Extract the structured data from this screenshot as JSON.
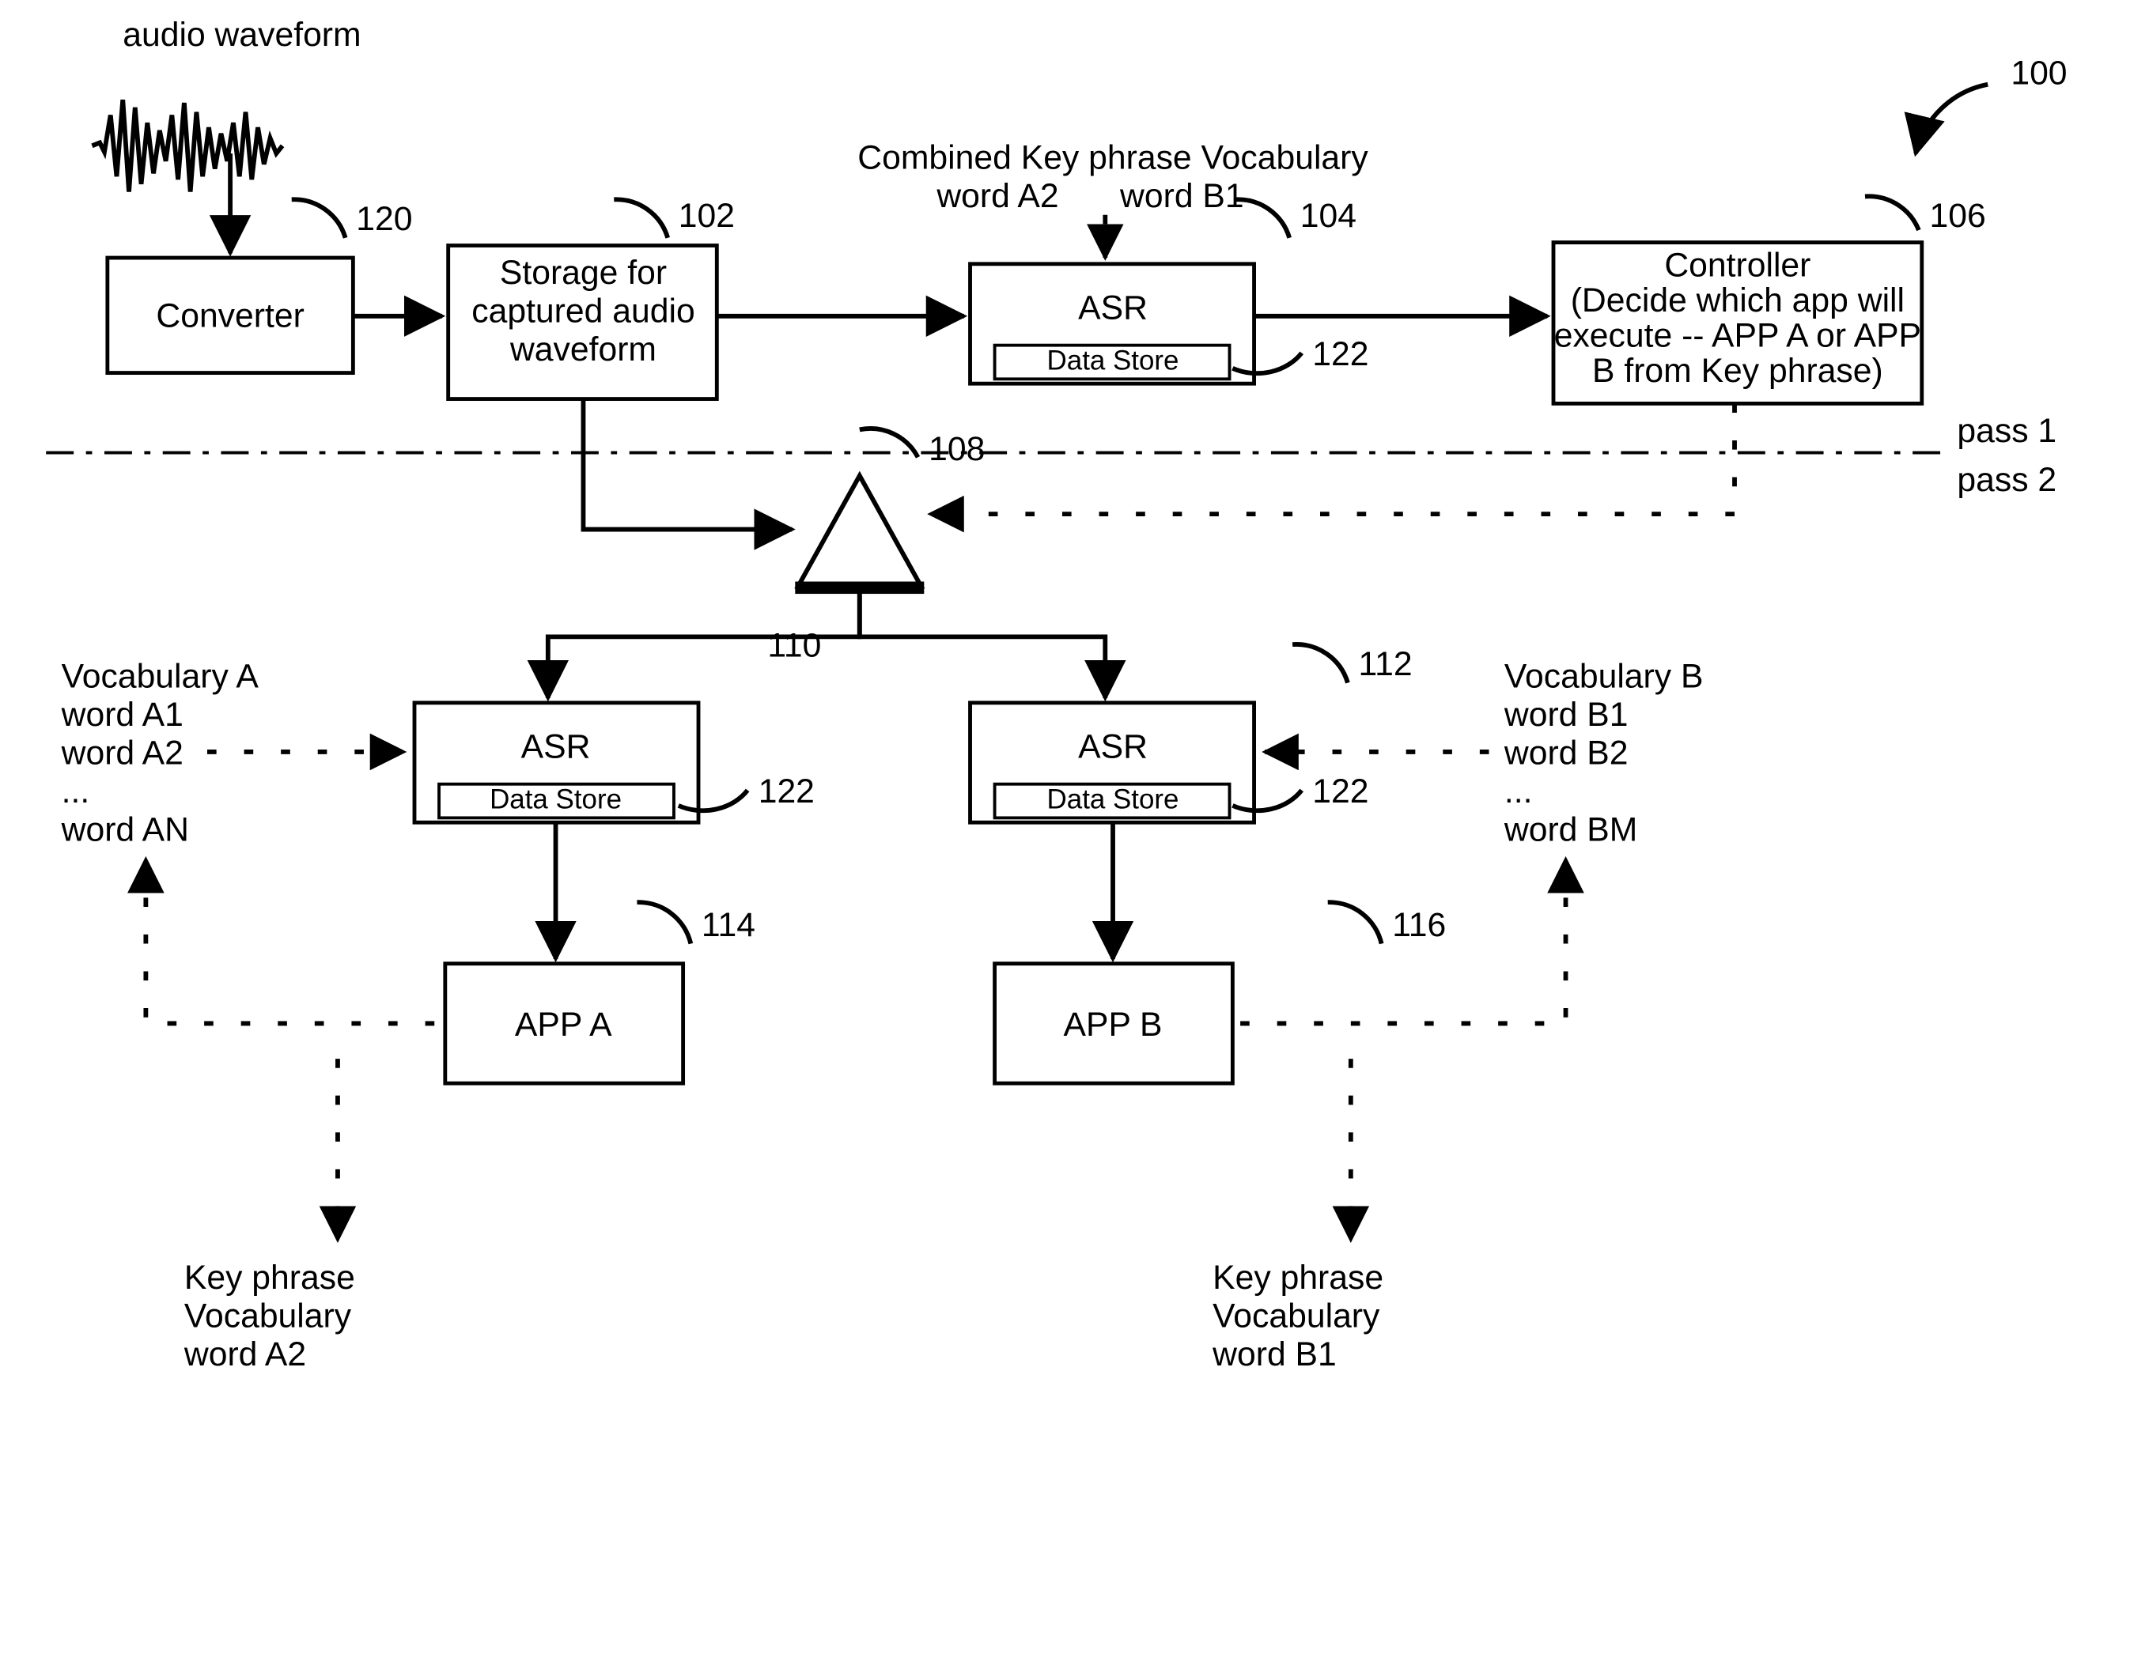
{
  "figure_ref": "100",
  "top_label": "audio waveform",
  "boxes": {
    "converter": {
      "title": "Converter",
      "ref": "120"
    },
    "storage": {
      "line1": "Storage for",
      "line2": "captured audio",
      "line3": "waveform",
      "ref": "102"
    },
    "asr1": {
      "title": "ASR",
      "sub": "Data Store",
      "ref": "104",
      "dsref": "122",
      "top1": "Combined Key phrase Vocabulary",
      "top2a": "word A2",
      "top2b": "word B1"
    },
    "controller": {
      "line1": "Controller",
      "line2": "(Decide which app will",
      "line3": "execute -- APP A or APP",
      "line4": "B from Key phrase)",
      "ref": "106"
    },
    "switch": {
      "ref": "108"
    },
    "asr2": {
      "title": "ASR",
      "sub": "Data Store",
      "ref": "110",
      "dsref": "122"
    },
    "asr3": {
      "title": "ASR",
      "sub": "Data Store",
      "ref": "112",
      "dsref": "122"
    },
    "appA": {
      "title": "APP A",
      "ref": "114"
    },
    "appB": {
      "title": "APP B",
      "ref": "116"
    }
  },
  "vocabA": {
    "l1": "Vocabulary A",
    "l2": "word A1",
    "l3": "word A2",
    "l4": "...",
    "l5": "word AN"
  },
  "vocabB": {
    "l1": "Vocabulary B",
    "l2": "word B1",
    "l3": "word B2",
    "l4": "...",
    "l5": "word BM"
  },
  "keyA": {
    "l1": "Key phrase",
    "l2": "Vocabulary",
    "l3": "word A2"
  },
  "keyB": {
    "l1": "Key phrase",
    "l2": "Vocabulary",
    "l3": "word B1"
  },
  "pass1": "pass 1",
  "pass2": "pass 2"
}
